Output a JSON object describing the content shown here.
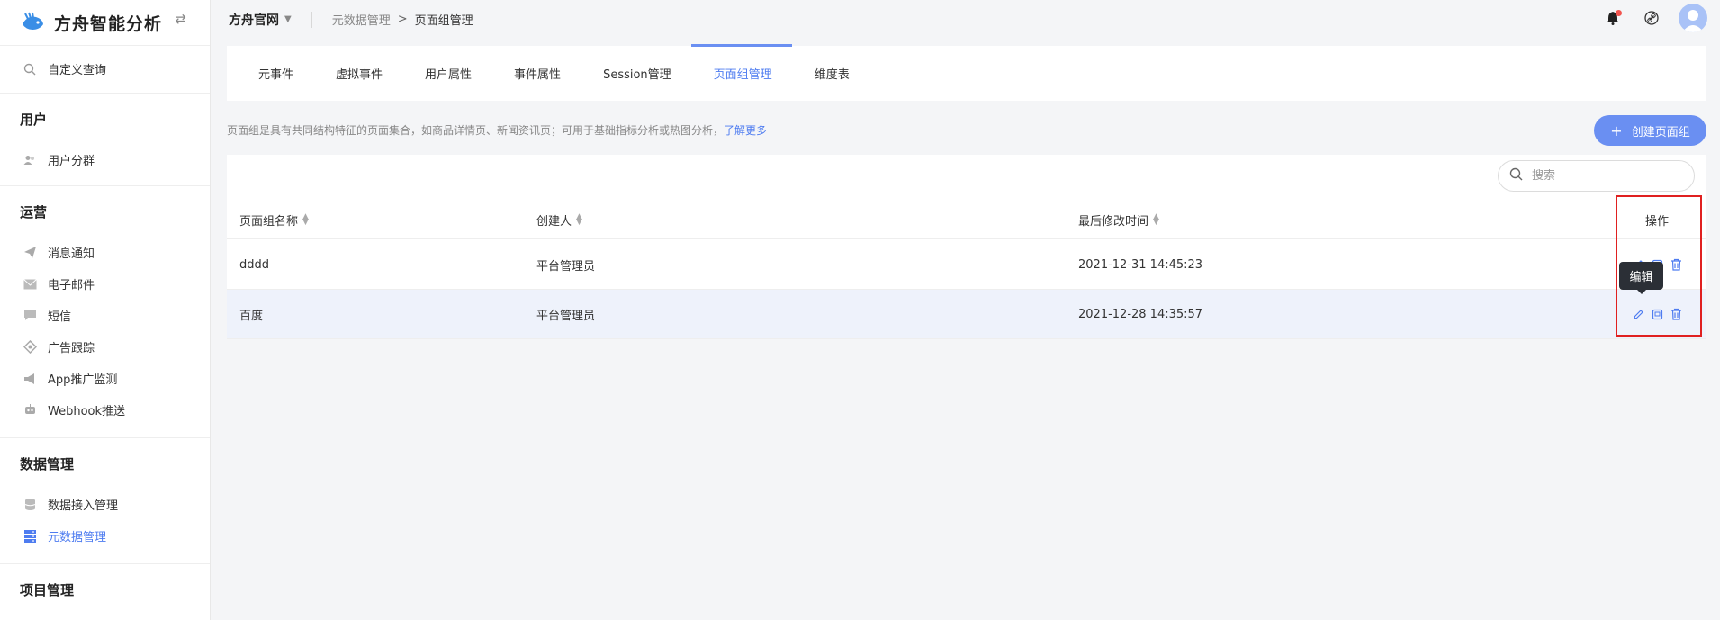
{
  "brand": {
    "name": "方舟智能分析",
    "logo_icon": "fish-logo-icon",
    "collapse_icon": "swap-arrows-icon"
  },
  "sidebar": {
    "top_items": [
      {
        "label": "自定义查询",
        "icon": "search-icon"
      }
    ],
    "sections": [
      {
        "title": "用户",
        "items": [
          {
            "label": "用户分群",
            "icon": "users-icon"
          }
        ]
      },
      {
        "title": "运营",
        "items": [
          {
            "label": "消息通知",
            "icon": "send-icon"
          },
          {
            "label": "电子邮件",
            "icon": "mail-icon"
          },
          {
            "label": "短信",
            "icon": "chat-icon"
          },
          {
            "label": "广告跟踪",
            "icon": "target-icon"
          },
          {
            "label": "App推广监测",
            "icon": "megaphone-icon"
          },
          {
            "label": "Webhook推送",
            "icon": "robot-icon"
          }
        ]
      },
      {
        "title": "数据管理",
        "items": [
          {
            "label": "数据接入管理",
            "icon": "database-icon"
          },
          {
            "label": "元数据管理",
            "icon": "server-icon",
            "active": true
          }
        ]
      },
      {
        "title": "项目管理",
        "items": []
      }
    ]
  },
  "topbar": {
    "project": "方舟官网",
    "breadcrumb": [
      "元数据管理",
      "页面组管理"
    ],
    "icons": [
      "bell-icon",
      "link-icon",
      "avatar"
    ]
  },
  "tabs": [
    "元事件",
    "虚拟事件",
    "用户属性",
    "事件属性",
    "Session管理",
    "页面组管理",
    "维度表"
  ],
  "active_tab": 5,
  "description": {
    "text": "页面组是具有共同结构特征的页面集合，如商品详情页、新闻资讯页；可用于基础指标分析或热图分析，",
    "link": "了解更多"
  },
  "create_button": "创建页面组",
  "search": {
    "placeholder": "搜索",
    "value": ""
  },
  "table": {
    "headers": [
      "页面组名称",
      "创建人",
      "最后修改时间",
      "操作"
    ],
    "rows": [
      {
        "name": "dddd",
        "creator": "平台管理员",
        "modified": "2021-12-31 14:45:23"
      },
      {
        "name": "百度",
        "creator": "平台管理员",
        "modified": "2021-12-28 14:35:57"
      }
    ]
  },
  "tooltip": "编辑",
  "colors": {
    "accent": "#4e7cf0",
    "button": "#6a8ff2",
    "highlight": "#e02020",
    "row_hover": "#eef2fb"
  }
}
